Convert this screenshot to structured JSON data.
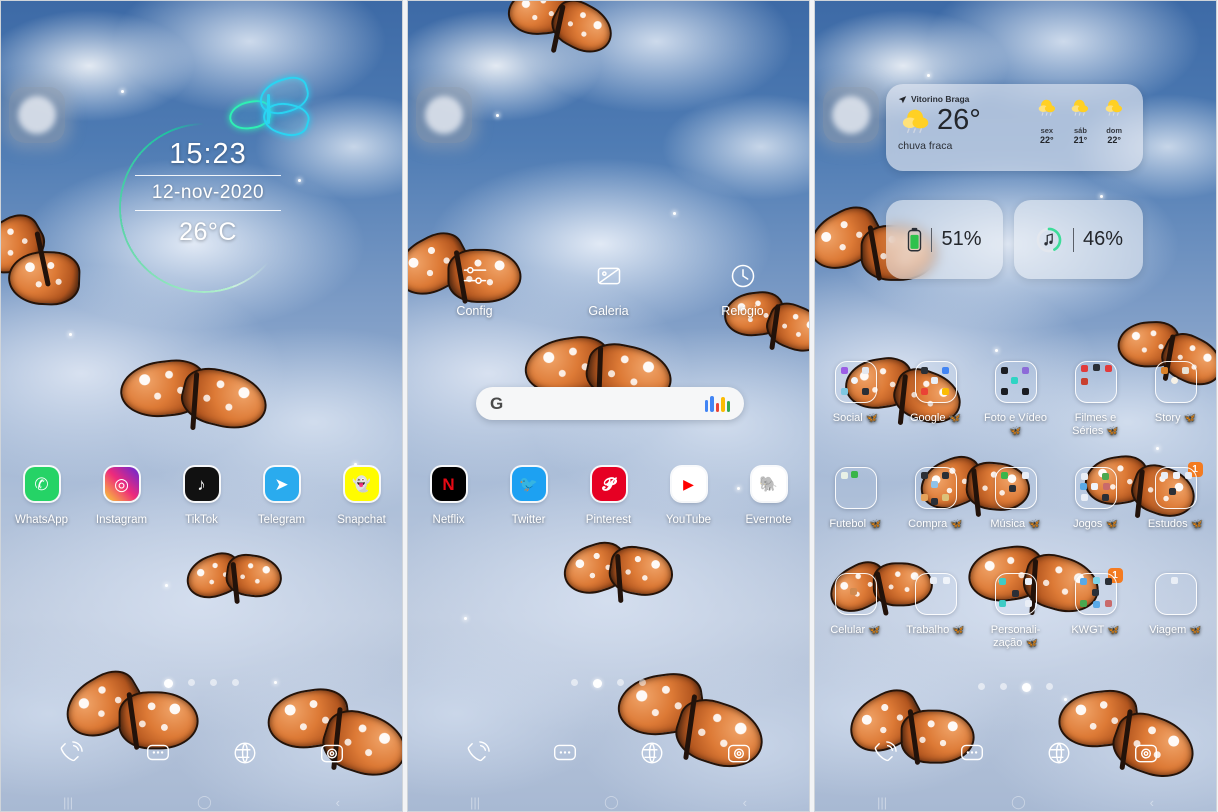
{
  "meta": {
    "accent_green": "#1fc2a0",
    "accent_orange": "#f47b20",
    "badge_text": "1"
  },
  "panels": [
    {
      "id": "panel-1",
      "clock_widget": {
        "time": "15:23",
        "date": "12-nov-2020",
        "temperature": "26°C"
      },
      "decor_icon": "neon-butterfly-icon",
      "apps": [
        {
          "name": "WhatsApp",
          "icon": "whatsapp-icon",
          "glyph": "✆",
          "bg": "#25D366",
          "fg": "#ffffff"
        },
        {
          "name": "Instagram",
          "icon": "instagram-icon",
          "glyph": "◎",
          "bg": "#C13584",
          "fg": "#ffffff"
        },
        {
          "name": "TikTok",
          "icon": "tiktok-icon",
          "glyph": "♪",
          "bg": "#111111",
          "fg": "#ffffff"
        },
        {
          "name": "Telegram",
          "icon": "telegram-icon",
          "glyph": "➤",
          "bg": "#2AABEE",
          "fg": "#ffffff"
        },
        {
          "name": "Snapchat",
          "icon": "snapchat-icon",
          "glyph": "👻",
          "bg": "#FFFC00",
          "fg": "#ffffff"
        }
      ],
      "page_dots": {
        "count": 4,
        "active": 1
      }
    },
    {
      "id": "panel-2",
      "utilities": [
        {
          "name": "Config",
          "icon": "settings-sliders-icon"
        },
        {
          "name": "Galeria",
          "icon": "gallery-image-icon"
        },
        {
          "name": "Relógio",
          "icon": "clock-icon"
        }
      ],
      "search": {
        "logo": "G",
        "placeholder": "",
        "value": "",
        "assistant_icon": "google-assistant-icon",
        "assistant_colors": [
          "#4285F4",
          "#EA4335",
          "#FBBC05",
          "#34A853"
        ]
      },
      "apps": [
        {
          "name": "Netflix",
          "icon": "netflix-icon",
          "glyph": "N",
          "bg": "#000000",
          "fg": "#E50914"
        },
        {
          "name": "Twitter",
          "icon": "twitter-icon",
          "glyph": "🐦",
          "bg": "#1DA1F2",
          "fg": "#ffffff"
        },
        {
          "name": "Pinterest",
          "icon": "pinterest-icon",
          "glyph": "𝓟",
          "bg": "#E60023",
          "fg": "#ffffff"
        },
        {
          "name": "YouTube",
          "icon": "youtube-icon",
          "glyph": "▶",
          "bg": "#ffffff",
          "fg": "#FF0000"
        },
        {
          "name": "Evernote",
          "icon": "evernote-icon",
          "glyph": "🐘",
          "bg": "#ffffff",
          "fg": "#00A82D"
        }
      ],
      "page_dots": {
        "count": 4,
        "active": 2
      }
    },
    {
      "id": "panel-3",
      "weather_widget": {
        "location": "Vitorino Braga",
        "location_icon": "location-arrow-icon",
        "current_icon": "sun-cloud-rain-icon",
        "temperature": "26°",
        "description": "chuva fraca",
        "forecast": [
          {
            "day": "sex",
            "temp": "22°",
            "icon": "sun-cloud-rain-icon"
          },
          {
            "day": "sáb",
            "temp": "21°",
            "icon": "sun-cloud-rain-icon"
          },
          {
            "day": "dom",
            "temp": "22°",
            "icon": "sun-cloud-rain-icon"
          }
        ]
      },
      "battery_widget": {
        "icon": "battery-icon",
        "value": "51%"
      },
      "music_widget": {
        "icon": "music-note-icon",
        "value": "46%"
      },
      "folders": [
        {
          "name": "Social",
          "emoji": "🦋",
          "badge": ""
        },
        {
          "name": "Google",
          "emoji": "🦋",
          "badge": ""
        },
        {
          "name": "Foto e Vídeo",
          "emoji": "🦋",
          "badge": ""
        },
        {
          "name": "Filmes e Séries",
          "emoji": "🦋",
          "badge": ""
        },
        {
          "name": "Story",
          "emoji": "🦋",
          "badge": ""
        },
        {
          "name": "Futebol",
          "emoji": "🦋",
          "badge": ""
        },
        {
          "name": "Compra",
          "emoji": "🦋",
          "badge": ""
        },
        {
          "name": "Música",
          "emoji": "🦋",
          "badge": ""
        },
        {
          "name": "Jogos",
          "emoji": "🦋",
          "badge": ""
        },
        {
          "name": "Estudos",
          "emoji": "🦋",
          "badge": "1"
        },
        {
          "name": "Celular",
          "emoji": "🦋",
          "badge": ""
        },
        {
          "name": "Trabalho",
          "emoji": "🦋",
          "badge": ""
        },
        {
          "name": "Personali-zação",
          "emoji": "🦋",
          "badge": ""
        },
        {
          "name": "KWGT",
          "emoji": "🦋",
          "badge": "1"
        },
        {
          "name": "Viagem",
          "emoji": "🦋",
          "badge": ""
        }
      ],
      "page_dots": {
        "count": 4,
        "active": 3
      }
    }
  ],
  "dock": [
    {
      "name": "Phone",
      "icon": "phone-icon"
    },
    {
      "name": "Messages",
      "icon": "messages-icon"
    },
    {
      "name": "Browser",
      "icon": "browser-globe-icon"
    },
    {
      "name": "Camera",
      "icon": "camera-icon"
    }
  ]
}
